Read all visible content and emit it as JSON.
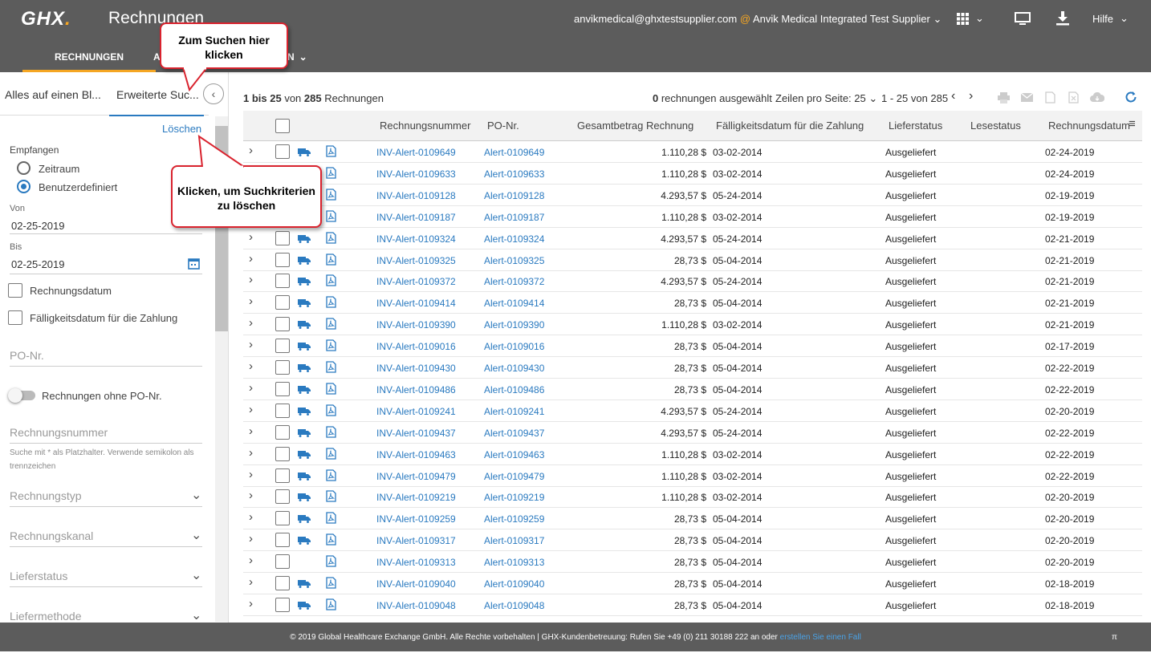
{
  "app": {
    "logo": "GHX",
    "logo_dot": ".",
    "title": "Rechnungen"
  },
  "user": {
    "email": "anvikmedical@ghxtestsupplier.com",
    "at": "@",
    "org": "Anvik Medical Integrated Test Supplier",
    "help": "Hilfe"
  },
  "nav": {
    "items": [
      {
        "label": "RECHNUNGEN"
      },
      {
        "label": "A"
      },
      {
        "label": "N"
      }
    ]
  },
  "left": {
    "tab1": "Alles auf einen Bl...",
    "tab2": "Erweiterte Suc...",
    "clear": "Löschen",
    "received": "Empfangen",
    "radio1": "Zeitraum",
    "radio2": "Benutzerdefiniert",
    "from_label": "Von",
    "from_value": "02-25-2019",
    "to_label": "Bis",
    "to_value": "02-25-2019",
    "cb1": "Rechnungsdatum",
    "cb2": "Fälligkeitsdatum für die Zahlung",
    "po_placeholder": "PO-Nr.",
    "toggle_label": "Rechnungen ohne PO-Nr.",
    "inv_placeholder": "Rechnungsnummer",
    "hint": "Suche mit * als Platzhalter. Verwende semikolon als trennzeichen",
    "dd1": "Rechnungstyp",
    "dd2": "Rechnungskanal",
    "dd3": "Lieferstatus",
    "dd4": "Liefermethode"
  },
  "toolbar": {
    "range_a": "1 bis 25",
    "range_b": " von ",
    "range_c": "285",
    "range_d": " Rechnungen",
    "selected_n": "0",
    "selected_t": " rechnungen ausgewählt",
    "rows_per_page": "Zeilen pro Seite: 25",
    "paging": "1 - 25 von 285"
  },
  "table": {
    "headers": [
      "Rechnungsnummer",
      "PO-Nr.",
      "Gesamtbetrag Rechnung",
      "Fälligkeitsdatum für die Zahlung",
      "Lieferstatus",
      "Lesestatus",
      "Rechnungsdatum"
    ],
    "rows": [
      {
        "inv": "INV-Alert-0109649",
        "po": "Alert-0109649",
        "amt": "1.110,28 $",
        "due": "03-02-2014",
        "status": "Ausgeliefert",
        "date": "02-24-2019",
        "truck": true
      },
      {
        "inv": "INV-Alert-0109633",
        "po": "Alert-0109633",
        "amt": "1.110,28 $",
        "due": "03-02-2014",
        "status": "Ausgeliefert",
        "date": "02-24-2019",
        "truck": true
      },
      {
        "inv": "INV-Alert-0109128",
        "po": "Alert-0109128",
        "amt": "4.293,57 $",
        "due": "05-24-2014",
        "status": "Ausgeliefert",
        "date": "02-19-2019",
        "truck": true
      },
      {
        "inv": "INV-Alert-0109187",
        "po": "Alert-0109187",
        "amt": "1.110,28 $",
        "due": "03-02-2014",
        "status": "Ausgeliefert",
        "date": "02-19-2019",
        "truck": true
      },
      {
        "inv": "INV-Alert-0109324",
        "po": "Alert-0109324",
        "amt": "4.293,57 $",
        "due": "05-24-2014",
        "status": "Ausgeliefert",
        "date": "02-21-2019",
        "truck": true
      },
      {
        "inv": "INV-Alert-0109325",
        "po": "Alert-0109325",
        "amt": "28,73 $",
        "due": "05-04-2014",
        "status": "Ausgeliefert",
        "date": "02-21-2019",
        "truck": true
      },
      {
        "inv": "INV-Alert-0109372",
        "po": "Alert-0109372",
        "amt": "4.293,57 $",
        "due": "05-24-2014",
        "status": "Ausgeliefert",
        "date": "02-21-2019",
        "truck": true
      },
      {
        "inv": "INV-Alert-0109414",
        "po": "Alert-0109414",
        "amt": "28,73 $",
        "due": "05-04-2014",
        "status": "Ausgeliefert",
        "date": "02-21-2019",
        "truck": true
      },
      {
        "inv": "INV-Alert-0109390",
        "po": "Alert-0109390",
        "amt": "1.110,28 $",
        "due": "03-02-2014",
        "status": "Ausgeliefert",
        "date": "02-21-2019",
        "truck": true
      },
      {
        "inv": "INV-Alert-0109016",
        "po": "Alert-0109016",
        "amt": "28,73 $",
        "due": "05-04-2014",
        "status": "Ausgeliefert",
        "date": "02-17-2019",
        "truck": true
      },
      {
        "inv": "INV-Alert-0109430",
        "po": "Alert-0109430",
        "amt": "28,73 $",
        "due": "05-04-2014",
        "status": "Ausgeliefert",
        "date": "02-22-2019",
        "truck": true
      },
      {
        "inv": "INV-Alert-0109486",
        "po": "Alert-0109486",
        "amt": "28,73 $",
        "due": "05-04-2014",
        "status": "Ausgeliefert",
        "date": "02-22-2019",
        "truck": true
      },
      {
        "inv": "INV-Alert-0109241",
        "po": "Alert-0109241",
        "amt": "4.293,57 $",
        "due": "05-24-2014",
        "status": "Ausgeliefert",
        "date": "02-20-2019",
        "truck": true
      },
      {
        "inv": "INV-Alert-0109437",
        "po": "Alert-0109437",
        "amt": "4.293,57 $",
        "due": "05-24-2014",
        "status": "Ausgeliefert",
        "date": "02-22-2019",
        "truck": true
      },
      {
        "inv": "INV-Alert-0109463",
        "po": "Alert-0109463",
        "amt": "1.110,28 $",
        "due": "03-02-2014",
        "status": "Ausgeliefert",
        "date": "02-22-2019",
        "truck": true
      },
      {
        "inv": "INV-Alert-0109479",
        "po": "Alert-0109479",
        "amt": "1.110,28 $",
        "due": "03-02-2014",
        "status": "Ausgeliefert",
        "date": "02-22-2019",
        "truck": true
      },
      {
        "inv": "INV-Alert-0109219",
        "po": "Alert-0109219",
        "amt": "1.110,28 $",
        "due": "03-02-2014",
        "status": "Ausgeliefert",
        "date": "02-20-2019",
        "truck": true
      },
      {
        "inv": "INV-Alert-0109259",
        "po": "Alert-0109259",
        "amt": "28,73 $",
        "due": "05-04-2014",
        "status": "Ausgeliefert",
        "date": "02-20-2019",
        "truck": true
      },
      {
        "inv": "INV-Alert-0109317",
        "po": "Alert-0109317",
        "amt": "28,73 $",
        "due": "05-04-2014",
        "status": "Ausgeliefert",
        "date": "02-20-2019",
        "truck": true
      },
      {
        "inv": "INV-Alert-0109313",
        "po": "Alert-0109313",
        "amt": "28,73 $",
        "due": "05-04-2014",
        "status": "Ausgeliefert",
        "date": "02-20-2019",
        "truck": false
      },
      {
        "inv": "INV-Alert-0109040",
        "po": "Alert-0109040",
        "amt": "28,73 $",
        "due": "05-04-2014",
        "status": "Ausgeliefert",
        "date": "02-18-2019",
        "truck": true
      },
      {
        "inv": "INV-Alert-0109048",
        "po": "Alert-0109048",
        "amt": "28,73 $",
        "due": "05-04-2014",
        "status": "Ausgeliefert",
        "date": "02-18-2019",
        "truck": true
      }
    ]
  },
  "callouts": {
    "search": "Zum Suchen hier klicken",
    "clear": "Klicken, um Suchkriterien zu löschen"
  },
  "footer": {
    "text": "© 2019 Global Healthcare Exchange GmbH. Alle Rechte vorbehalten | GHX-Kundenbetreuung: Rufen Sie +49 (0) 211 30188 222 an oder ",
    "link": "erstellen Sie einen Fall",
    "corner": "π"
  },
  "colors": {
    "header": "#5c5c5c",
    "accent": "#f5a623",
    "link": "#2a7ac0",
    "callout_border": "#d9232e"
  }
}
